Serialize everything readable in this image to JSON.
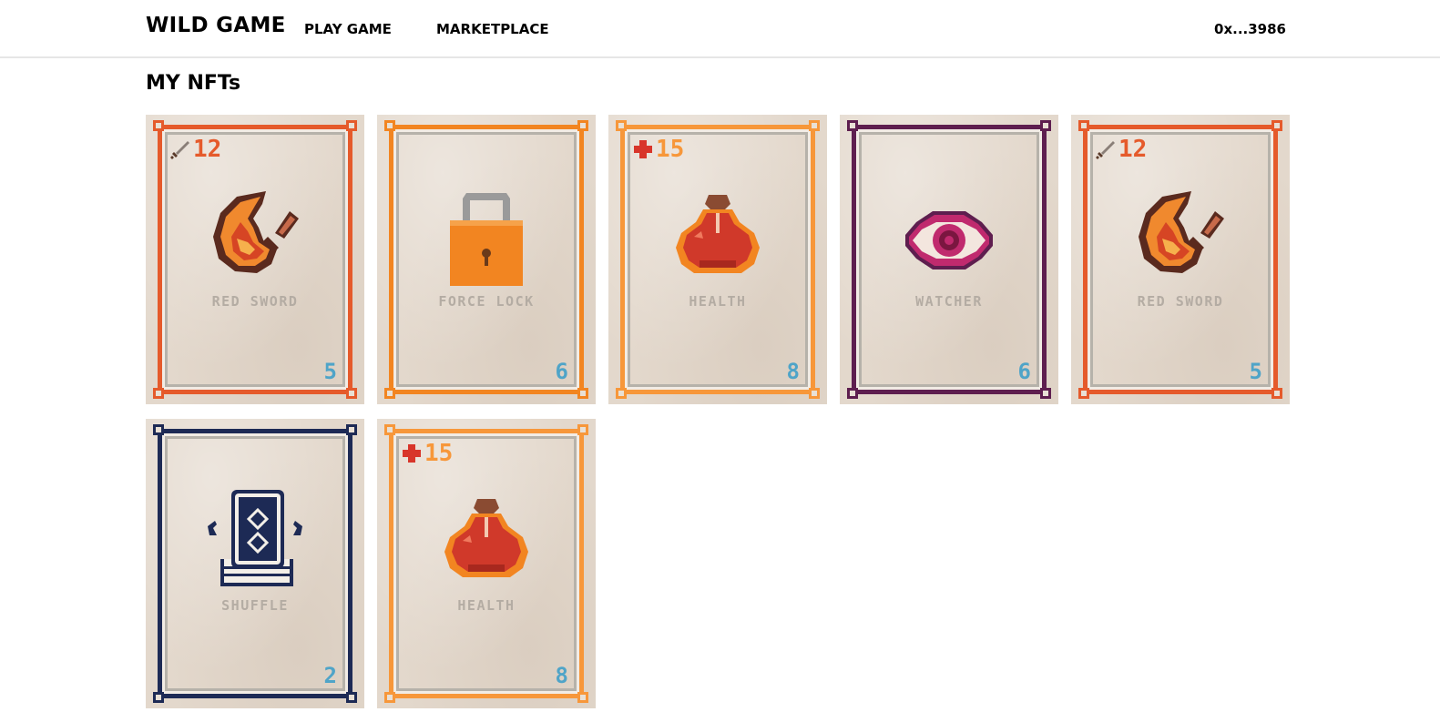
{
  "header": {
    "logo": "WILD GAME",
    "nav": {
      "play": "PLAY GAME",
      "marketplace": "MARKETPLACE"
    },
    "wallet": "0x...3986"
  },
  "page": {
    "title": "MY NFTs"
  },
  "colors": {
    "red_frame": "#e55a2b",
    "orange_frame": "#f28521",
    "light_orange_frame": "#f7973a",
    "purple_frame": "#5e1e4f",
    "navy_frame": "#1d2a55",
    "cost_text": "#4fa4c8"
  },
  "cards": [
    {
      "name": "RED SWORD",
      "cost": "5",
      "stat": "12",
      "stat_icon": "sword-icon",
      "art": "flame-sword"
    },
    {
      "name": "FORCE LOCK",
      "cost": "6",
      "stat": "",
      "stat_icon": "",
      "art": "padlock"
    },
    {
      "name": "HEALTH",
      "cost": "8",
      "stat": "15",
      "stat_icon": "plus-icon",
      "art": "potion"
    },
    {
      "name": "WATCHER",
      "cost": "6",
      "stat": "",
      "stat_icon": "",
      "art": "eye"
    },
    {
      "name": "RED SWORD",
      "cost": "5",
      "stat": "12",
      "stat_icon": "sword-icon",
      "art": "flame-sword"
    },
    {
      "name": "SHUFFLE",
      "cost": "2",
      "stat": "",
      "stat_icon": "",
      "art": "card-deck"
    },
    {
      "name": "HEALTH",
      "cost": "8",
      "stat": "15",
      "stat_icon": "plus-icon",
      "art": "potion"
    }
  ]
}
